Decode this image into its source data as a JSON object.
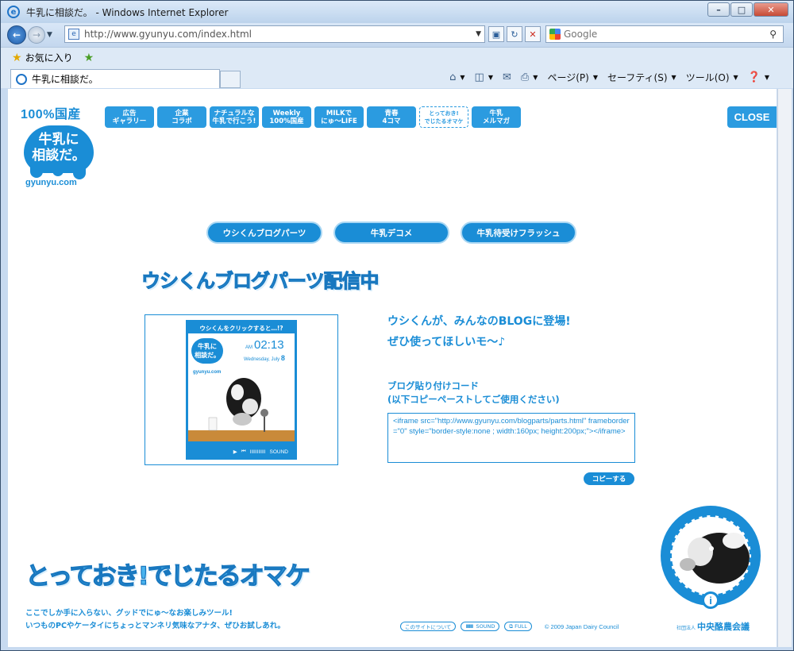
{
  "window": {
    "title": "牛乳に相談だ。 - Windows Internet Explorer",
    "controls": {
      "minimize": "–",
      "maximize": "□",
      "close": "✕"
    }
  },
  "address_bar": {
    "url": "http://www.gyunyu.com/index.html",
    "search_placeholder": "Google"
  },
  "favorites": {
    "label": "お気に入り"
  },
  "tab": {
    "title": "牛乳に相談だ。"
  },
  "command_bar": [
    {
      "label": "ページ(P)"
    },
    {
      "label": "セーフティ(S)"
    },
    {
      "label": "ツール(O)"
    }
  ],
  "site": {
    "brand_pct": "100%国産",
    "logo_line1": "牛乳に",
    "logo_line2": "相談だ。",
    "logo_url": "gyunyu.com",
    "nav": [
      {
        "line1": "広告",
        "line2": "ギャラリー"
      },
      {
        "line1": "企業",
        "line2": "コラボ"
      },
      {
        "line1": "ナチュラルな",
        "line2": "牛乳で行こう!"
      },
      {
        "line1": "Weekly",
        "line2": "100%国産"
      },
      {
        "line1": "MILKで",
        "line2": "にゅ〜LIFE"
      },
      {
        "line1": "青春",
        "line2": "4コマ"
      },
      {
        "line1": "とっておき!",
        "line2": "でじたるオマケ"
      },
      {
        "line1": "牛乳",
        "line2": "メルマガ"
      }
    ],
    "close_label": "CLOSE",
    "pills": [
      "ウシくんブログパーツ",
      "牛乳デコメ",
      "牛乳待受けフラッシュ"
    ],
    "headline": "ウシくんブログパーツ配信中",
    "widget": {
      "header": "ウシくんをクリックすると…!?",
      "logo_line1": "牛乳に",
      "logo_line2": "相談だ。",
      "url": "gyunyu.com",
      "am": "AM",
      "time": "02:13",
      "date_text": "Wednesday, July",
      "date_day": "8",
      "play": "▶",
      "skip": "⏮",
      "sound_bars": "IIIIIIIIIII",
      "sound": "SOUND"
    },
    "promo_line1": "ウシくんが、みんなのBLOGに登場!",
    "promo_line2": "ぜひ使ってほしいモ〜♪",
    "code_label_line1": "ブログ貼り付けコード",
    "code_label_line2": "(以下コピーペーストしてご使用ください)",
    "code": "<iframe src=\"http://www.gyunyu.com/blogparts/parts.html\" frameborder=\"0\" style=\"border-style:none ; width:160px; height:200px;\"></iframe>",
    "copy_label": "コピーする",
    "omake": "とっておき!でじたるオマケ",
    "tagline1": "ここでしか手に入らない、グッドでにゅ〜なお楽しみツール!",
    "tagline2": "いつものPCやケータイにちょっとマンネリ気味なアナタ、ぜひお試しあれ。",
    "footer": {
      "about": "このサイトについて",
      "sound_bars": "IIIIIIIIII",
      "sound": "SOUND",
      "full": "FULL",
      "copyright": "© 2009 Japan Dairy Council",
      "council_prefix": "社団法人",
      "council": "中央酪農会議"
    },
    "info_mark": "i"
  },
  "colors": {
    "brand": "#1a8dd6",
    "chrome": "#c7daf0"
  }
}
